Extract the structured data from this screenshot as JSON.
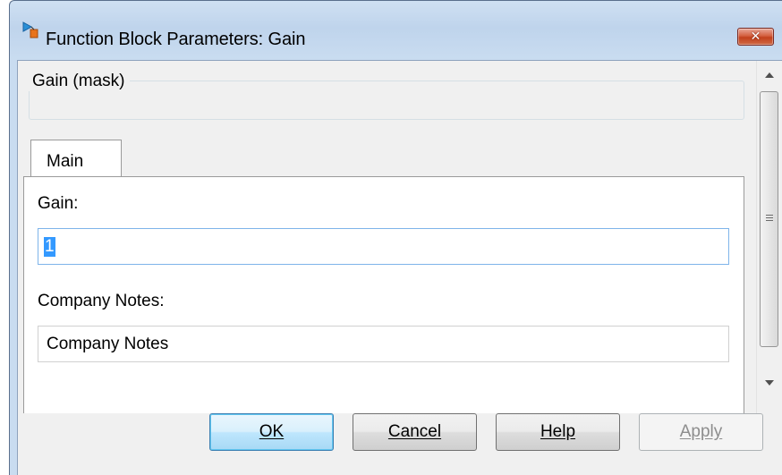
{
  "window": {
    "title": "Function Block Parameters: Gain",
    "close_glyph": "✕"
  },
  "mask": {
    "group_label": "Gain (mask)"
  },
  "tabs": [
    {
      "label": "Main",
      "active": true
    }
  ],
  "fields": {
    "gain": {
      "label": "Gain:",
      "value": "1",
      "selected": true
    },
    "notes": {
      "label": "Company Notes:",
      "value": "Company Notes"
    }
  },
  "buttons": {
    "ok": {
      "label": "OK",
      "enabled": true
    },
    "cancel": {
      "label": "Cancel",
      "enabled": true
    },
    "help": {
      "label": "Help",
      "enabled": true
    },
    "apply": {
      "label": "Apply",
      "enabled": false
    }
  },
  "icons": {
    "title": "simulink-block-icon",
    "scroll_up": "chevron-up-icon",
    "scroll_down": "chevron-down-icon"
  },
  "colors": {
    "title_bar": "#bfd4ec",
    "close_button": "#c2401c",
    "selection": "#3399ff",
    "focus_border": "#7eb4ea",
    "default_button": "#bee6fd"
  }
}
